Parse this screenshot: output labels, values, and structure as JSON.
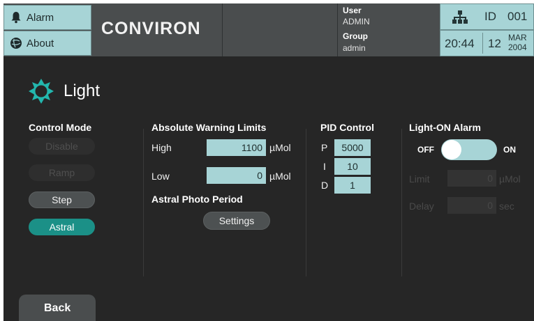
{
  "header": {
    "alarm_label": "Alarm",
    "about_label": "About",
    "logo": "CONVIRON",
    "user_label": "User",
    "user_value": "ADMIN",
    "group_label": "Group",
    "group_value": "admin",
    "id_label": "ID",
    "id_value": "001",
    "time": "20:44",
    "day": "12",
    "month": "MAR",
    "year": "2004"
  },
  "page": {
    "title": "Light"
  },
  "control_mode": {
    "title": "Control Mode",
    "buttons": [
      {
        "label": "Disable",
        "state": "disabled"
      },
      {
        "label": "Ramp",
        "state": "disabled"
      },
      {
        "label": "Step",
        "state": "normal"
      },
      {
        "label": "Astral",
        "state": "active"
      }
    ]
  },
  "warning_limits": {
    "title": "Absolute Warning Limits",
    "high_label": "High",
    "high_value": "1100",
    "high_unit": "µMol",
    "low_label": "Low",
    "low_value": "0",
    "low_unit": "µMol"
  },
  "photo_period": {
    "title": "Astral Photo Period",
    "settings_label": "Settings"
  },
  "pid": {
    "title": "PID Control",
    "p_label": "P",
    "p_value": "5000",
    "i_label": "I",
    "i_value": "10",
    "d_label": "D",
    "d_value": "1"
  },
  "light_on_alarm": {
    "title": "Light-ON Alarm",
    "off_label": "OFF",
    "on_label": "ON",
    "toggle_state": "off",
    "limit_label": "Limit",
    "limit_value": "0",
    "limit_unit": "µMol",
    "delay_label": "Delay",
    "delay_value": "0",
    "delay_unit": "sec"
  },
  "footer": {
    "back_label": "Back"
  },
  "colors": {
    "accent": "#a7d4d6",
    "active": "#1b9087",
    "background": "#262626",
    "header": "#4a4d4e"
  }
}
